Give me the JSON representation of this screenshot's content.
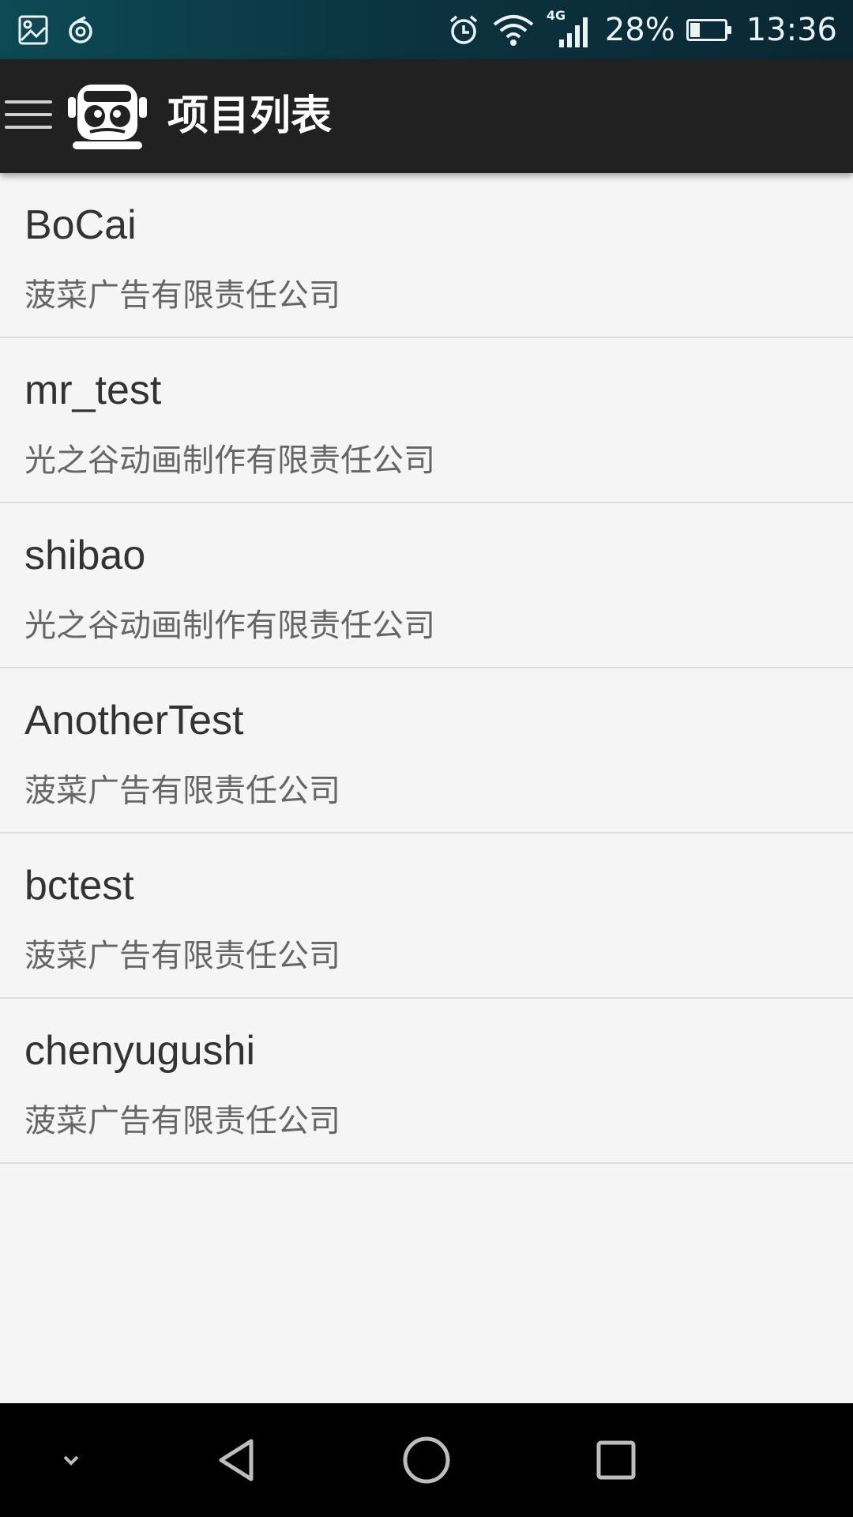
{
  "status_bar": {
    "battery_percent_text": "28%",
    "battery_level": 0.28,
    "time": "13:36",
    "network_label": "4G"
  },
  "app_bar": {
    "title": "项目列表"
  },
  "projects": [
    {
      "name": "BoCai",
      "company": "菠菜广告有限责任公司"
    },
    {
      "name": "mr_test",
      "company": "光之谷动画制作有限责任公司"
    },
    {
      "name": "shibao",
      "company": "光之谷动画制作有限责任公司"
    },
    {
      "name": "AnotherTest",
      "company": "菠菜广告有限责任公司"
    },
    {
      "name": "bctest",
      "company": "菠菜广告有限责任公司"
    },
    {
      "name": "chenyugushi",
      "company": "菠菜广告有限责任公司"
    }
  ],
  "colors": {
    "app_bar": "#212121",
    "status_bar": "#0b3440",
    "background": "#f5f5f5",
    "divider": "#dcdcdc"
  }
}
